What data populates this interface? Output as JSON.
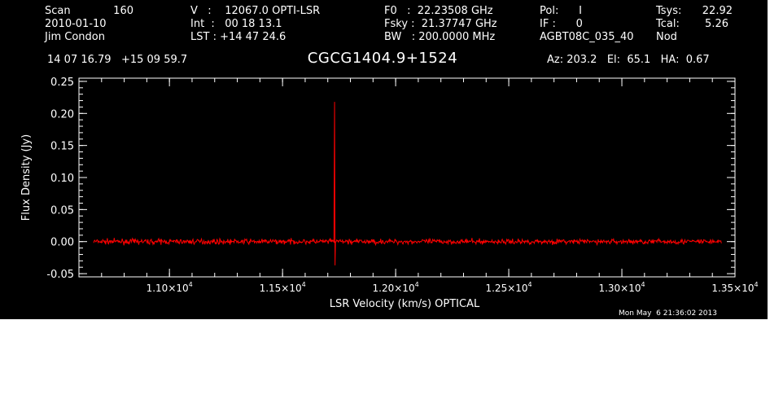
{
  "header": {
    "col1": [
      "Scan",
      "2010-01-10",
      "Jim Condon"
    ],
    "scan_number": "160",
    "col2": [
      "V   :    12067.0 OPTI-LSR",
      "Int  :   00 18 13.1",
      "LST : +14 47 24.6"
    ],
    "col3": [
      "F0   :  22.23508 GHz",
      "Fsky :  21.37747 GHz",
      "BW   : 200.0000 MHz"
    ],
    "col4": [
      "Pol:      I",
      "IF :      0",
      "AGBT08C_035_40"
    ],
    "col5": [
      "Tsys:",
      "Tcal:",
      "Nod"
    ],
    "col5_values": [
      "22.92",
      "5.26",
      ""
    ],
    "coords": "14 07 16.79   +15 09 59.7",
    "source": "CGCG1404.9+1524",
    "az_el_ha": "Az: 203.2   El:  65.1   HA:  0.67",
    "timestamp": "Mon May  6 21:36:02 2013"
  },
  "chart_data": {
    "type": "line",
    "title": "CGCG1404.9+1524",
    "xlabel": "LSR Velocity (km/s) OPTICAL",
    "ylabel": "Flux Density (Jy)",
    "xlim": [
      10600,
      13500
    ],
    "ylim": [
      -0.055,
      0.255
    ],
    "x_ticks": [
      11000,
      11500,
      12000,
      12500,
      13000,
      13500
    ],
    "x_tick_labels": [
      {
        "mant": "1.10×10",
        "exp": "4"
      },
      {
        "mant": "1.15×10",
        "exp": "4"
      },
      {
        "mant": "1.20×10",
        "exp": "4"
      },
      {
        "mant": "1.25×10",
        "exp": "4"
      },
      {
        "mant": "1.30×10",
        "exp": "4"
      },
      {
        "mant": "1.35×10",
        "exp": "4"
      }
    ],
    "y_ticks": [
      -0.05,
      0.0,
      0.05,
      0.1,
      0.15,
      0.2,
      0.25
    ],
    "y_tick_labels": [
      "-0.05",
      "0.00",
      "0.05",
      "0.10",
      "0.15",
      "0.20",
      "0.25"
    ],
    "series": [
      {
        "color": "#ff0000",
        "x_range": [
          10665,
          13440
        ],
        "baseline": 0.0,
        "noise_rms": 0.002,
        "features": [
          {
            "x": 11730,
            "peak": 0.218
          },
          {
            "x": 11732,
            "peak": -0.037
          }
        ]
      }
    ],
    "background": "#000000",
    "axis_color": "#ffffff"
  }
}
